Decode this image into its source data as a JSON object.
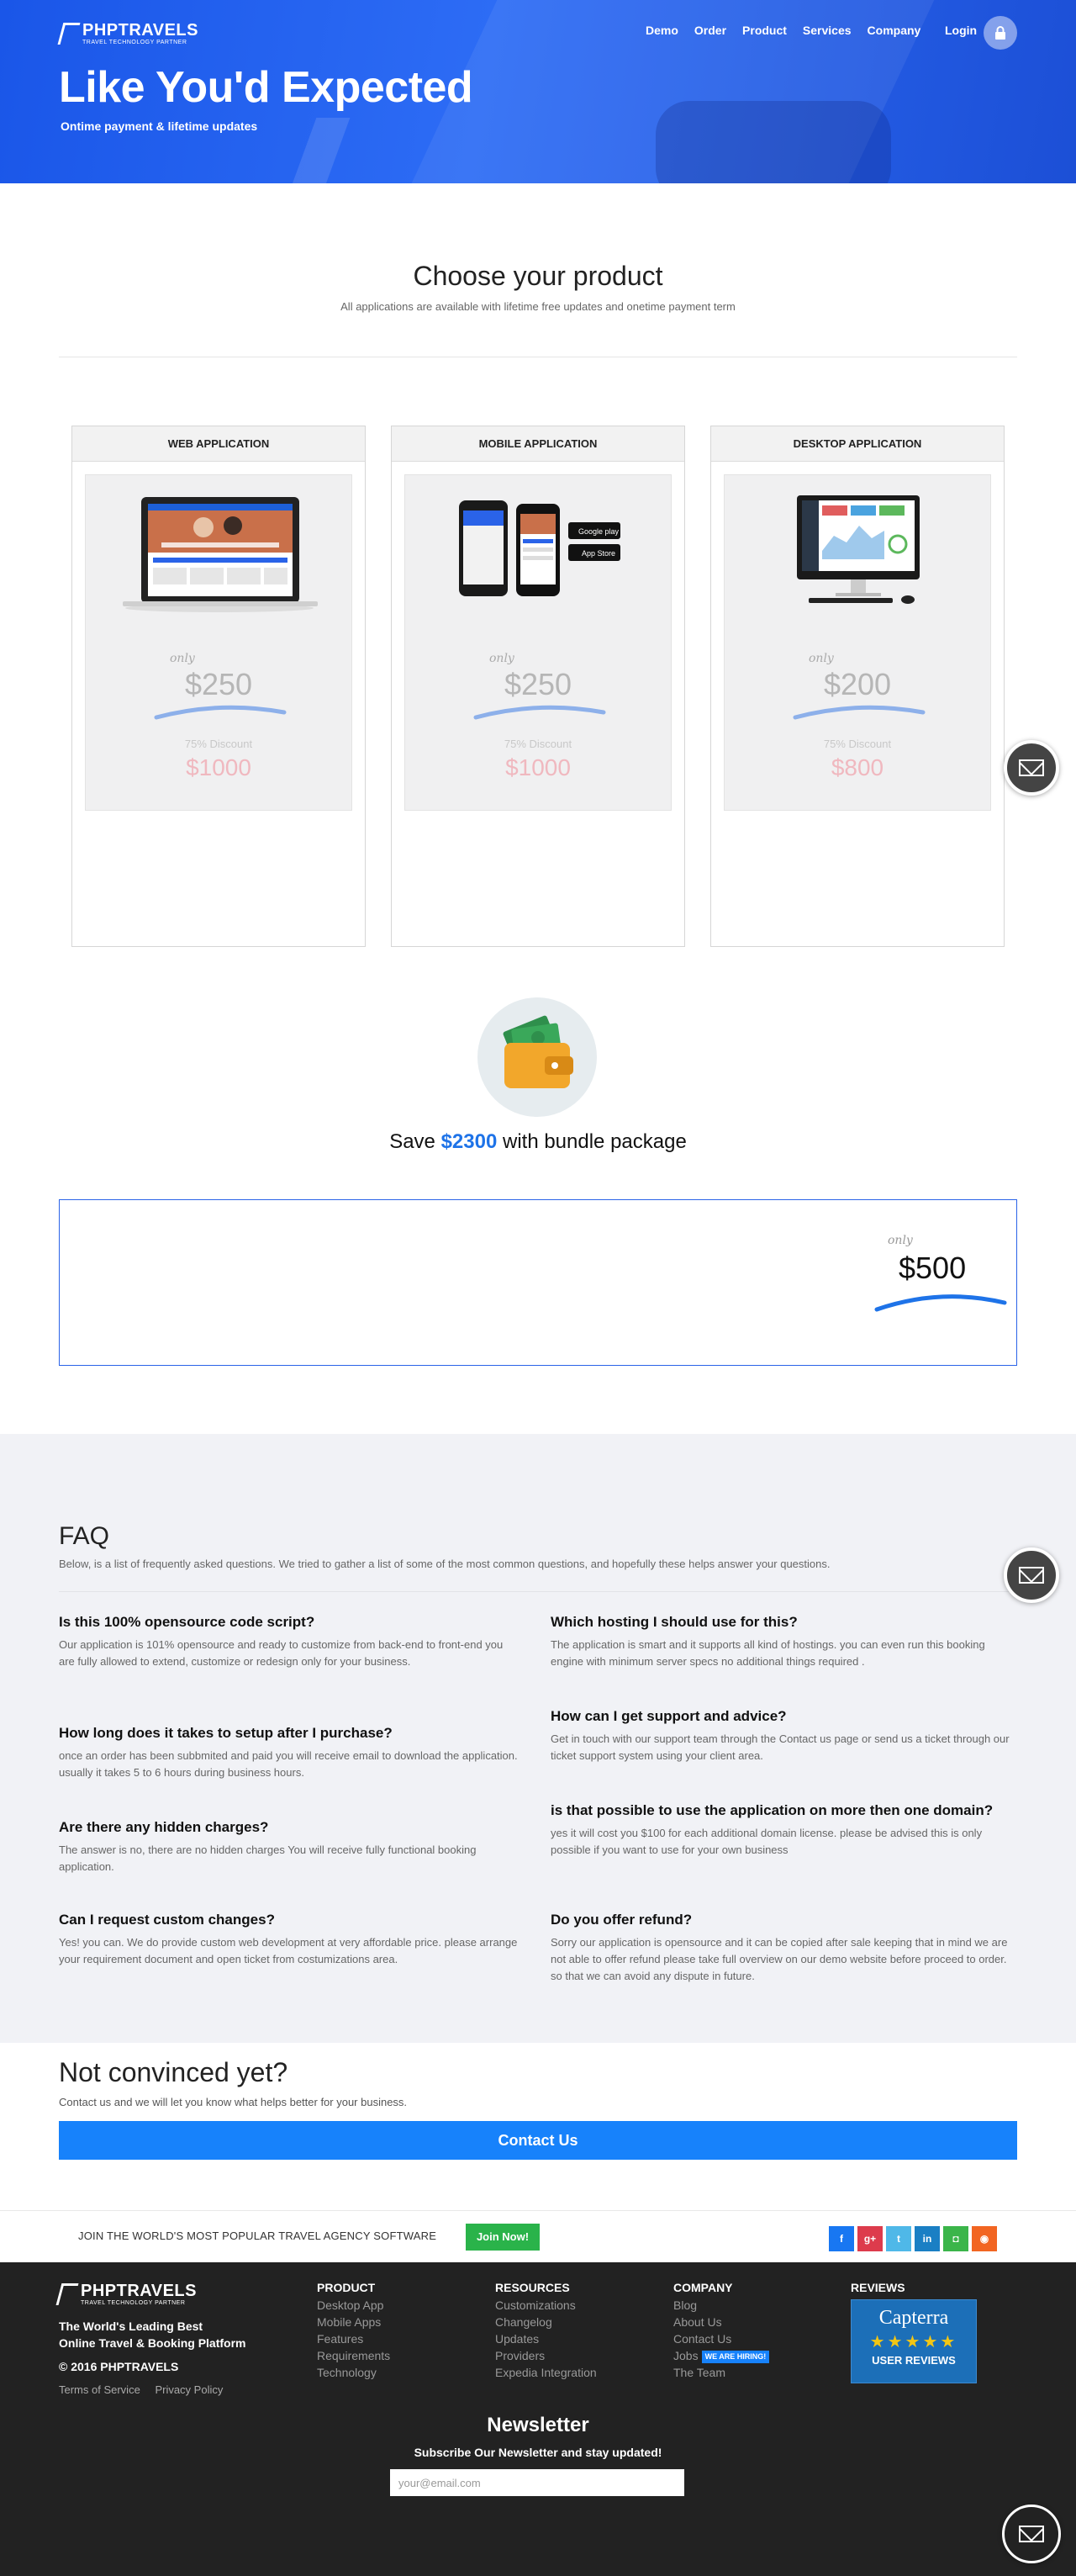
{
  "header": {
    "brand": "PHPTRAVELS",
    "brand_sub": "TRAVEL TECHNOLOGY PARTNER",
    "nav": [
      "Demo",
      "Order",
      "Product",
      "Services",
      "Company"
    ],
    "login": "Login",
    "title": "Like You'd Expected",
    "subtitle": "Ontime payment & lifetime updates"
  },
  "choose": {
    "title": "Choose your product",
    "subtitle": "All applications are available with lifetime free updates and onetime payment term"
  },
  "products": [
    {
      "name": "WEB APPLICATION",
      "only": "only",
      "price": "$250",
      "discount": "75% Discount",
      "old_price": "$1000"
    },
    {
      "name": "MOBILE APPLICATION",
      "only": "only",
      "price": "$250",
      "discount": "75% Discount",
      "old_price": "$1000"
    },
    {
      "name": "DESKTOP APPLICATION",
      "only": "only",
      "price": "$200",
      "discount": "75% Discount",
      "old_price": "$800"
    }
  ],
  "store_badges": {
    "google": "Google play",
    "apple": "App Store"
  },
  "bundle": {
    "save_prefix": "Save",
    "save_amount": "$2300",
    "save_suffix": "with bundle package",
    "only": "only",
    "price": "$500"
  },
  "faq": {
    "title": "FAQ",
    "subtitle": "Below, is a list of frequently asked questions. We tried to gather a list of some of the most common questions, and hopefully these helps answer your questions.",
    "items": [
      {
        "q": "Is this 100% opensource code script?",
        "a": "Our application is 101% opensource and ready to customize from back-end to front-end you are fully allowed to extend, customize or redesign only for your business."
      },
      {
        "q": "Which hosting I should use for this?",
        "a": "The application is smart and it supports all kind of hostings. you can even run this booking engine with minimum server specs no additional things required ."
      },
      {
        "q": "How long does it takes to setup after I purchase?",
        "a": "once an order has been subbmited and paid you will receive email to download the application. usually it takes 5 to 6 hours during business hours."
      },
      {
        "q": "How can I get support and advice?",
        "a": "Get in touch with our support team through the Contact us page or send us a ticket through our ticket support system using your client area."
      },
      {
        "q": "Are there any hidden charges?",
        "a": "The answer is no, there are no hidden charges You will receive fully functional booking application."
      },
      {
        "q": "is that possible to use the application on more then one domain?",
        "a": "yes it will cost you $100 for each additional domain license. please be advised this is only possible if you want to use for your own business"
      },
      {
        "q": "Can I request custom changes?",
        "a": "Yes! you can. We do provide custom web development at very affordable price. please arrange your requirement document and open ticket from costumizations area."
      },
      {
        "q": "Do you offer refund?",
        "a": "Sorry our application is opensource and it can be copied after sale keeping that in mind we are not able to offer refund please take full overview on our demo website before proceed to order. so that we can avoid any dispute in future."
      }
    ]
  },
  "not_convinced": {
    "title": "Not convinced yet?",
    "subtitle": "Contact us and we will let you know what helps better for your business.",
    "button": "Contact Us"
  },
  "join": {
    "text": "JOIN THE WORLD'S MOST POPULAR TRAVEL AGENCY SOFTWARE",
    "button": "Join Now!"
  },
  "social": [
    {
      "icon": "facebook-icon",
      "glyph": "f",
      "color": "#1877f2"
    },
    {
      "icon": "google-plus-icon",
      "glyph": "g+",
      "color": "#dd3b4c"
    },
    {
      "icon": "twitter-icon",
      "glyph": "t",
      "color": "#4fb8e8"
    },
    {
      "icon": "linkedin-icon",
      "glyph": "in",
      "color": "#1a7fc4"
    },
    {
      "icon": "instagram-icon",
      "glyph": "◘",
      "color": "#3bb54a"
    },
    {
      "icon": "rss-icon",
      "glyph": "◉",
      "color": "#f26522"
    }
  ],
  "footer": {
    "brand": "PHPTRAVELS",
    "brand_sub": "TRAVEL TECHNOLOGY PARTNER",
    "tagline_1": "The World's Leading Best",
    "tagline_2": "Online Travel & Booking Platform",
    "copyright": "© 2016 PHPTRAVELS",
    "terms": "Terms of Service",
    "privacy": "Privacy Policy",
    "product": {
      "title": "PRODUCT",
      "links": [
        "Desktop App",
        "Mobile Apps",
        "Features",
        "Requirements",
        "Technology"
      ]
    },
    "resources": {
      "title": "RESOURCES",
      "links": [
        "Customizations",
        "Changelog",
        "Updates",
        "Providers",
        "Expedia Integration"
      ]
    },
    "company": {
      "title": "COMPANY",
      "links": [
        "Blog",
        "About Us",
        "Contact Us",
        "Jobs",
        "The Team"
      ],
      "hiring_badge": "WE ARE HIRING!"
    },
    "reviews": {
      "title": "REVIEWS",
      "capterra": "Capterra",
      "stars": "★★★★★",
      "user_reviews": "USER REVIEWS"
    },
    "newsletter": {
      "title": "Newsletter",
      "subtitle": "Subscribe Our Newsletter and stay updated!",
      "placeholder": "your@email.com"
    }
  }
}
